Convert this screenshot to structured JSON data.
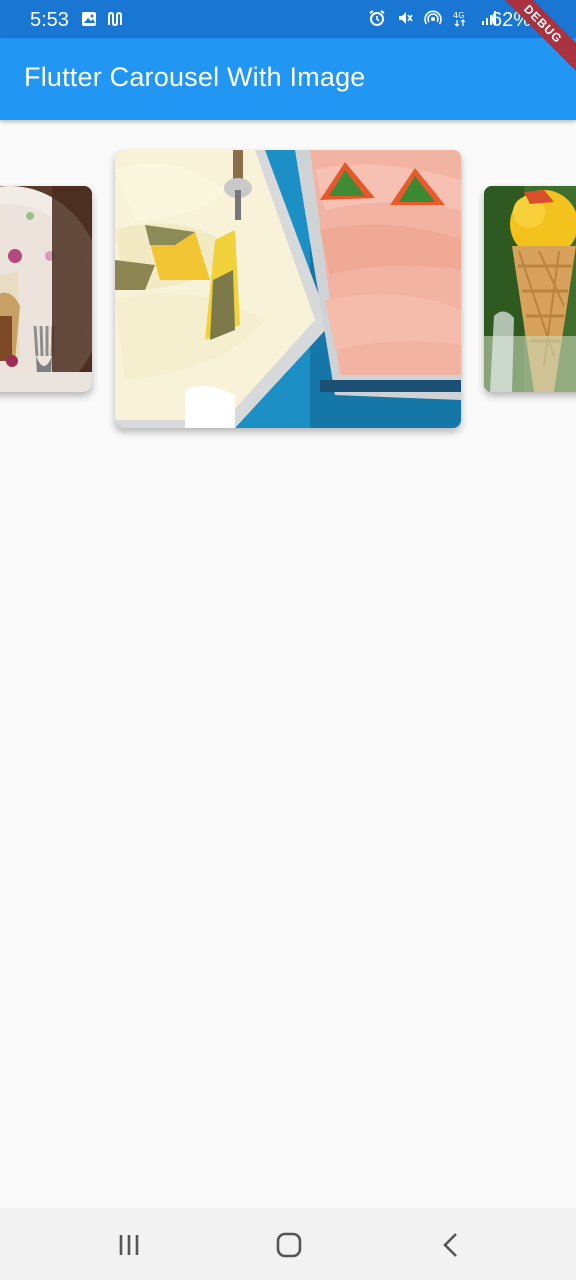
{
  "status_bar": {
    "time": "5:53",
    "battery": "62%"
  },
  "app_bar": {
    "title": "Flutter Carousel With Image"
  },
  "debug_banner": {
    "label": "DEBUG"
  },
  "carousel": {
    "items": [
      {
        "subject": "plate-with-fork-image"
      },
      {
        "subject": "gelato-trays-image"
      },
      {
        "subject": "ice-cream-cone-image"
      }
    ]
  },
  "nav_bar": {
    "icons": [
      "recents-icon",
      "home-icon",
      "back-icon"
    ]
  },
  "colors": {
    "status_bar": "#1976d2",
    "app_bar": "#2196f3",
    "background": "#fafafa",
    "nav_bar": "#f2f2f2",
    "debug_banner": "#a8323f"
  }
}
